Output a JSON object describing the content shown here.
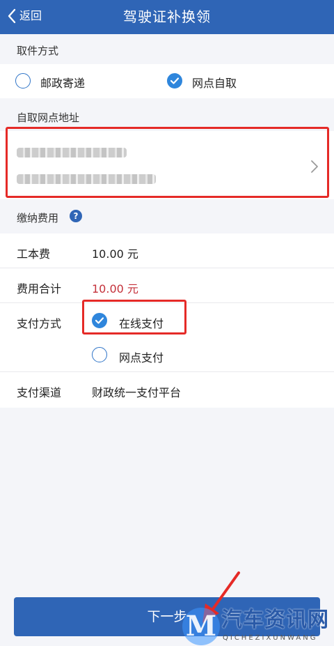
{
  "header": {
    "back_label": "返回",
    "title": "驾驶证补换领"
  },
  "pickup": {
    "section_label": "取件方式",
    "options": [
      {
        "label": "邮政寄递",
        "checked": false
      },
      {
        "label": "网点自取",
        "checked": true
      }
    ]
  },
  "address": {
    "section_label": "自取网点地址"
  },
  "fees": {
    "section_label": "缴纳费用",
    "help_glyph": "?",
    "rows": [
      {
        "label": "工本费",
        "value": "10.00 元"
      },
      {
        "label": "费用合计",
        "value": "10.00 元"
      }
    ]
  },
  "payment": {
    "label": "支付方式",
    "options": [
      {
        "label": "在线支付",
        "checked": true
      },
      {
        "label": "网点支付",
        "checked": false
      }
    ],
    "channel_label": "支付渠道",
    "channel_value": "财政统一支付平台"
  },
  "footer": {
    "next_label": "下一步"
  },
  "watermark": {
    "logo_letter": "M",
    "text": "汽车资讯网",
    "subtext": "QICHEZIXUNWANG"
  },
  "colors": {
    "primary": "#2f65b6",
    "check": "#2f86dc",
    "highlight": "#e52a27",
    "total": "#c4313a"
  }
}
